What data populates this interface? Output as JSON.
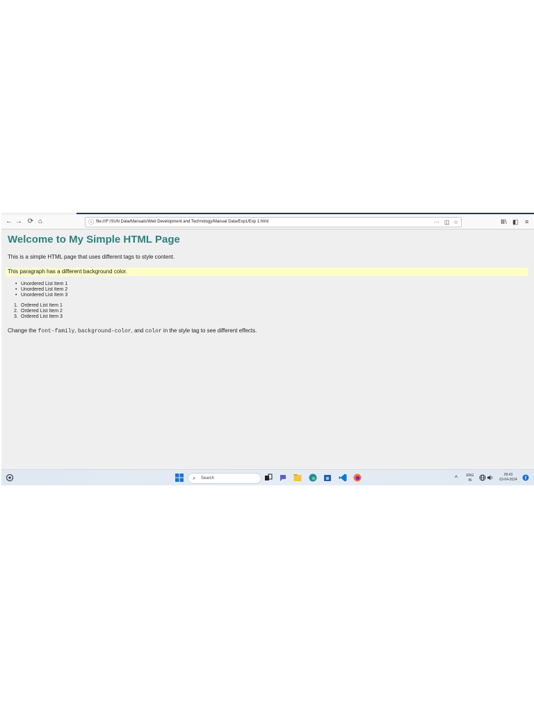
{
  "browser": {
    "back_icon": "←",
    "forward_icon": "→",
    "reload_icon": "⟳",
    "home_icon": "⌂",
    "info_icon": "ⓘ",
    "url": "file:///F:/SUN Data/Manuals/Web Development and Technology/Manual Data/Exp1/Exp 1.html",
    "more_icon": "···",
    "pocket_icon": "◫",
    "bookmark_icon": "☆",
    "library_icon": "Ⅲ\\",
    "sidebar_icon": "◧",
    "menu_icon": "≡"
  },
  "page": {
    "title": "Welcome to My Simple HTML Page",
    "intro": "This is a simple HTML page that uses different tags to style content.",
    "highlight": "This paragraph has a different background color.",
    "unordered": [
      "Unordered List Item 1",
      "Unordered List Item 2",
      "Unordered List Item 3"
    ],
    "ordered": [
      "Ordered List Item 1",
      "Ordered List Item 2",
      "Ordered List Item 3"
    ],
    "footer_prefix": "Change the ",
    "footer_code1": "font-family",
    "footer_sep1": ", ",
    "footer_code2": "background-color",
    "footer_sep2": ", and ",
    "footer_code3": "color",
    "footer_suffix": " in the style tag to see different effects.",
    "highlight_color": "#fdfdc8",
    "title_color": "#2e7f7f"
  },
  "taskbar": {
    "search_placeholder": "Search",
    "lang": "ENG",
    "region": "IN",
    "time": "09:43",
    "date": "03-04-2024"
  }
}
